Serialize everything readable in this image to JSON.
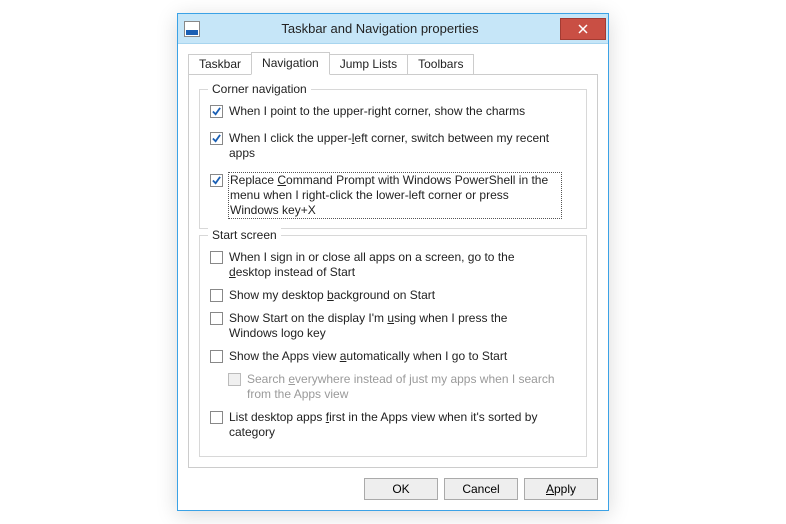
{
  "window": {
    "title": "Taskbar and Navigation properties"
  },
  "tabs": [
    {
      "label": "Taskbar",
      "active": false
    },
    {
      "label": "Navigation",
      "active": true
    },
    {
      "label": "Jump Lists",
      "active": false
    },
    {
      "label": "Toolbars",
      "active": false
    }
  ],
  "groups": {
    "corner": {
      "title": "Corner navigation",
      "items": [
        {
          "label": "When I point to the upper-right corner, show the charms",
          "checked": true
        },
        {
          "label": "When I click the upper-left corner, switch between my recent apps",
          "checked": true
        },
        {
          "label": "Replace Command Prompt with Windows PowerShell in the menu when I right-click the lower-left corner or press Windows key+X",
          "checked": true,
          "focused": true
        }
      ]
    },
    "start": {
      "title": "Start screen",
      "items": [
        {
          "label": "When I sign in or close all apps on a screen, go to the desktop instead of Start",
          "checked": false
        },
        {
          "label": "Show my desktop background on Start",
          "checked": false
        },
        {
          "label": "Show Start on the display I'm using when I press the Windows logo key",
          "checked": false
        },
        {
          "label": "Show the Apps view automatically when I go to Start",
          "checked": false
        },
        {
          "label": "Search everywhere instead of just my apps when I search from the Apps view",
          "checked": false,
          "disabled": true,
          "sub": true
        },
        {
          "label": "List desktop apps first in the Apps view when it's sorted by category",
          "checked": false
        }
      ]
    }
  },
  "buttons": {
    "ok": "OK",
    "cancel": "Cancel",
    "apply": "Apply"
  }
}
